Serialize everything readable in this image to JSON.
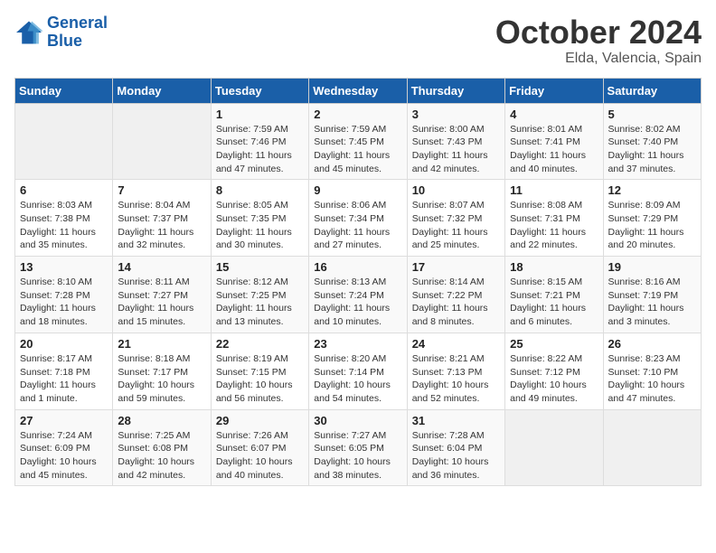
{
  "header": {
    "logo_line1": "General",
    "logo_line2": "Blue",
    "month": "October 2024",
    "location": "Elda, Valencia, Spain"
  },
  "weekdays": [
    "Sunday",
    "Monday",
    "Tuesday",
    "Wednesday",
    "Thursday",
    "Friday",
    "Saturday"
  ],
  "weeks": [
    [
      {
        "day": "",
        "info": ""
      },
      {
        "day": "",
        "info": ""
      },
      {
        "day": "1",
        "info": "Sunrise: 7:59 AM\nSunset: 7:46 PM\nDaylight: 11 hours and 47 minutes."
      },
      {
        "day": "2",
        "info": "Sunrise: 7:59 AM\nSunset: 7:45 PM\nDaylight: 11 hours and 45 minutes."
      },
      {
        "day": "3",
        "info": "Sunrise: 8:00 AM\nSunset: 7:43 PM\nDaylight: 11 hours and 42 minutes."
      },
      {
        "day": "4",
        "info": "Sunrise: 8:01 AM\nSunset: 7:41 PM\nDaylight: 11 hours and 40 minutes."
      },
      {
        "day": "5",
        "info": "Sunrise: 8:02 AM\nSunset: 7:40 PM\nDaylight: 11 hours and 37 minutes."
      }
    ],
    [
      {
        "day": "6",
        "info": "Sunrise: 8:03 AM\nSunset: 7:38 PM\nDaylight: 11 hours and 35 minutes."
      },
      {
        "day": "7",
        "info": "Sunrise: 8:04 AM\nSunset: 7:37 PM\nDaylight: 11 hours and 32 minutes."
      },
      {
        "day": "8",
        "info": "Sunrise: 8:05 AM\nSunset: 7:35 PM\nDaylight: 11 hours and 30 minutes."
      },
      {
        "day": "9",
        "info": "Sunrise: 8:06 AM\nSunset: 7:34 PM\nDaylight: 11 hours and 27 minutes."
      },
      {
        "day": "10",
        "info": "Sunrise: 8:07 AM\nSunset: 7:32 PM\nDaylight: 11 hours and 25 minutes."
      },
      {
        "day": "11",
        "info": "Sunrise: 8:08 AM\nSunset: 7:31 PM\nDaylight: 11 hours and 22 minutes."
      },
      {
        "day": "12",
        "info": "Sunrise: 8:09 AM\nSunset: 7:29 PM\nDaylight: 11 hours and 20 minutes."
      }
    ],
    [
      {
        "day": "13",
        "info": "Sunrise: 8:10 AM\nSunset: 7:28 PM\nDaylight: 11 hours and 18 minutes."
      },
      {
        "day": "14",
        "info": "Sunrise: 8:11 AM\nSunset: 7:27 PM\nDaylight: 11 hours and 15 minutes."
      },
      {
        "day": "15",
        "info": "Sunrise: 8:12 AM\nSunset: 7:25 PM\nDaylight: 11 hours and 13 minutes."
      },
      {
        "day": "16",
        "info": "Sunrise: 8:13 AM\nSunset: 7:24 PM\nDaylight: 11 hours and 10 minutes."
      },
      {
        "day": "17",
        "info": "Sunrise: 8:14 AM\nSunset: 7:22 PM\nDaylight: 11 hours and 8 minutes."
      },
      {
        "day": "18",
        "info": "Sunrise: 8:15 AM\nSunset: 7:21 PM\nDaylight: 11 hours and 6 minutes."
      },
      {
        "day": "19",
        "info": "Sunrise: 8:16 AM\nSunset: 7:19 PM\nDaylight: 11 hours and 3 minutes."
      }
    ],
    [
      {
        "day": "20",
        "info": "Sunrise: 8:17 AM\nSunset: 7:18 PM\nDaylight: 11 hours and 1 minute."
      },
      {
        "day": "21",
        "info": "Sunrise: 8:18 AM\nSunset: 7:17 PM\nDaylight: 10 hours and 59 minutes."
      },
      {
        "day": "22",
        "info": "Sunrise: 8:19 AM\nSunset: 7:15 PM\nDaylight: 10 hours and 56 minutes."
      },
      {
        "day": "23",
        "info": "Sunrise: 8:20 AM\nSunset: 7:14 PM\nDaylight: 10 hours and 54 minutes."
      },
      {
        "day": "24",
        "info": "Sunrise: 8:21 AM\nSunset: 7:13 PM\nDaylight: 10 hours and 52 minutes."
      },
      {
        "day": "25",
        "info": "Sunrise: 8:22 AM\nSunset: 7:12 PM\nDaylight: 10 hours and 49 minutes."
      },
      {
        "day": "26",
        "info": "Sunrise: 8:23 AM\nSunset: 7:10 PM\nDaylight: 10 hours and 47 minutes."
      }
    ],
    [
      {
        "day": "27",
        "info": "Sunrise: 7:24 AM\nSunset: 6:09 PM\nDaylight: 10 hours and 45 minutes."
      },
      {
        "day": "28",
        "info": "Sunrise: 7:25 AM\nSunset: 6:08 PM\nDaylight: 10 hours and 42 minutes."
      },
      {
        "day": "29",
        "info": "Sunrise: 7:26 AM\nSunset: 6:07 PM\nDaylight: 10 hours and 40 minutes."
      },
      {
        "day": "30",
        "info": "Sunrise: 7:27 AM\nSunset: 6:05 PM\nDaylight: 10 hours and 38 minutes."
      },
      {
        "day": "31",
        "info": "Sunrise: 7:28 AM\nSunset: 6:04 PM\nDaylight: 10 hours and 36 minutes."
      },
      {
        "day": "",
        "info": ""
      },
      {
        "day": "",
        "info": ""
      }
    ]
  ]
}
